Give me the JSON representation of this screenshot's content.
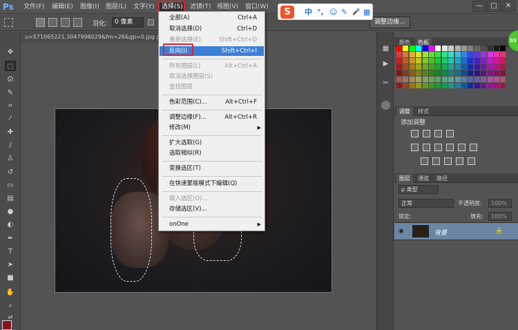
{
  "app": {
    "logo": "Ps"
  },
  "menubar": {
    "items": [
      {
        "label": "文件(F)"
      },
      {
        "label": "编辑(E)"
      },
      {
        "label": "图像(I)"
      },
      {
        "label": "图层(L)"
      },
      {
        "label": "文字(Y)"
      },
      {
        "label": "选择(S)"
      },
      {
        "label": "滤镜(T)"
      },
      {
        "label": "视图(V)"
      },
      {
        "label": "窗口(W)"
      }
    ],
    "window_buttons": [
      "—",
      "□",
      "✕"
    ]
  },
  "options_bar": {
    "feather_label": "羽化:",
    "feather_value": "0 像素",
    "refine_edge_button": "调整边缘..."
  },
  "ime": {
    "logo": "S",
    "items": [
      "中",
      "°,",
      "☺",
      "✎",
      "🎤",
      "▦"
    ]
  },
  "document": {
    "tab_title": "u=571065221,3047998029&fm=26&gp=0.jpg @"
  },
  "select_menu": {
    "items": [
      {
        "label": "全部(A)",
        "shortcut": "Ctrl+A",
        "disabled": false
      },
      {
        "label": "取消选择(D)",
        "shortcut": "Ctrl+D",
        "disabled": false
      },
      {
        "label": "重新选择(E)",
        "shortcut": "Shift+Ctrl+D",
        "disabled": true
      },
      {
        "label": "反向(I)",
        "shortcut": "Shift+Ctrl+I",
        "disabled": false,
        "highlighted": true
      },
      {
        "label": "所有图层(L)",
        "shortcut": "Alt+Ctrl+A",
        "disabled": true
      },
      {
        "label": "取消选择图层(S)",
        "shortcut": "",
        "disabled": true
      },
      {
        "label": "查找图层",
        "shortcut": "",
        "disabled": true
      },
      {
        "label": "色彩范围(C)...",
        "shortcut": "Alt+Ctrl+F",
        "disabled": false
      },
      {
        "label": "调整边缘(F)...",
        "shortcut": "Alt+Ctrl+R",
        "disabled": false
      },
      {
        "label": "修改(M)",
        "shortcut": "",
        "disabled": false,
        "submenu": true
      },
      {
        "label": "扩大选取(G)",
        "shortcut": "",
        "disabled": false
      },
      {
        "label": "选取相似(R)",
        "shortcut": "",
        "disabled": false
      },
      {
        "label": "变换选区(T)",
        "shortcut": "",
        "disabled": false
      },
      {
        "label": "在快速蒙版模式下编辑(Q)",
        "shortcut": "",
        "disabled": false
      },
      {
        "label": "载入选区(O)...",
        "shortcut": "",
        "disabled": true
      },
      {
        "label": "存储选区(V)...",
        "shortcut": "",
        "disabled": false
      },
      {
        "label": "onOne",
        "shortcut": "",
        "disabled": false,
        "submenu": true
      }
    ]
  },
  "panels": {
    "swatches_tabs": [
      "颜色",
      "色板"
    ],
    "adjust_tabs": [
      "调整",
      "样式"
    ],
    "adjust_title": "添加调整",
    "layers_tabs": [
      "图层",
      "通道",
      "路径"
    ],
    "kind_filter": "ρ 类型",
    "blend_mode": "正常",
    "opacity_label": "不透明度:",
    "opacity_value": "100%",
    "lock_label": "锁定:",
    "fill_label": "填充:",
    "fill_value": "100%",
    "layer_name": "背景"
  },
  "colors": {
    "accent": "#3c7fd6",
    "highlight_box": "#e0222b",
    "foreground": "#8a1020"
  },
  "badge": {
    "text": "55"
  }
}
